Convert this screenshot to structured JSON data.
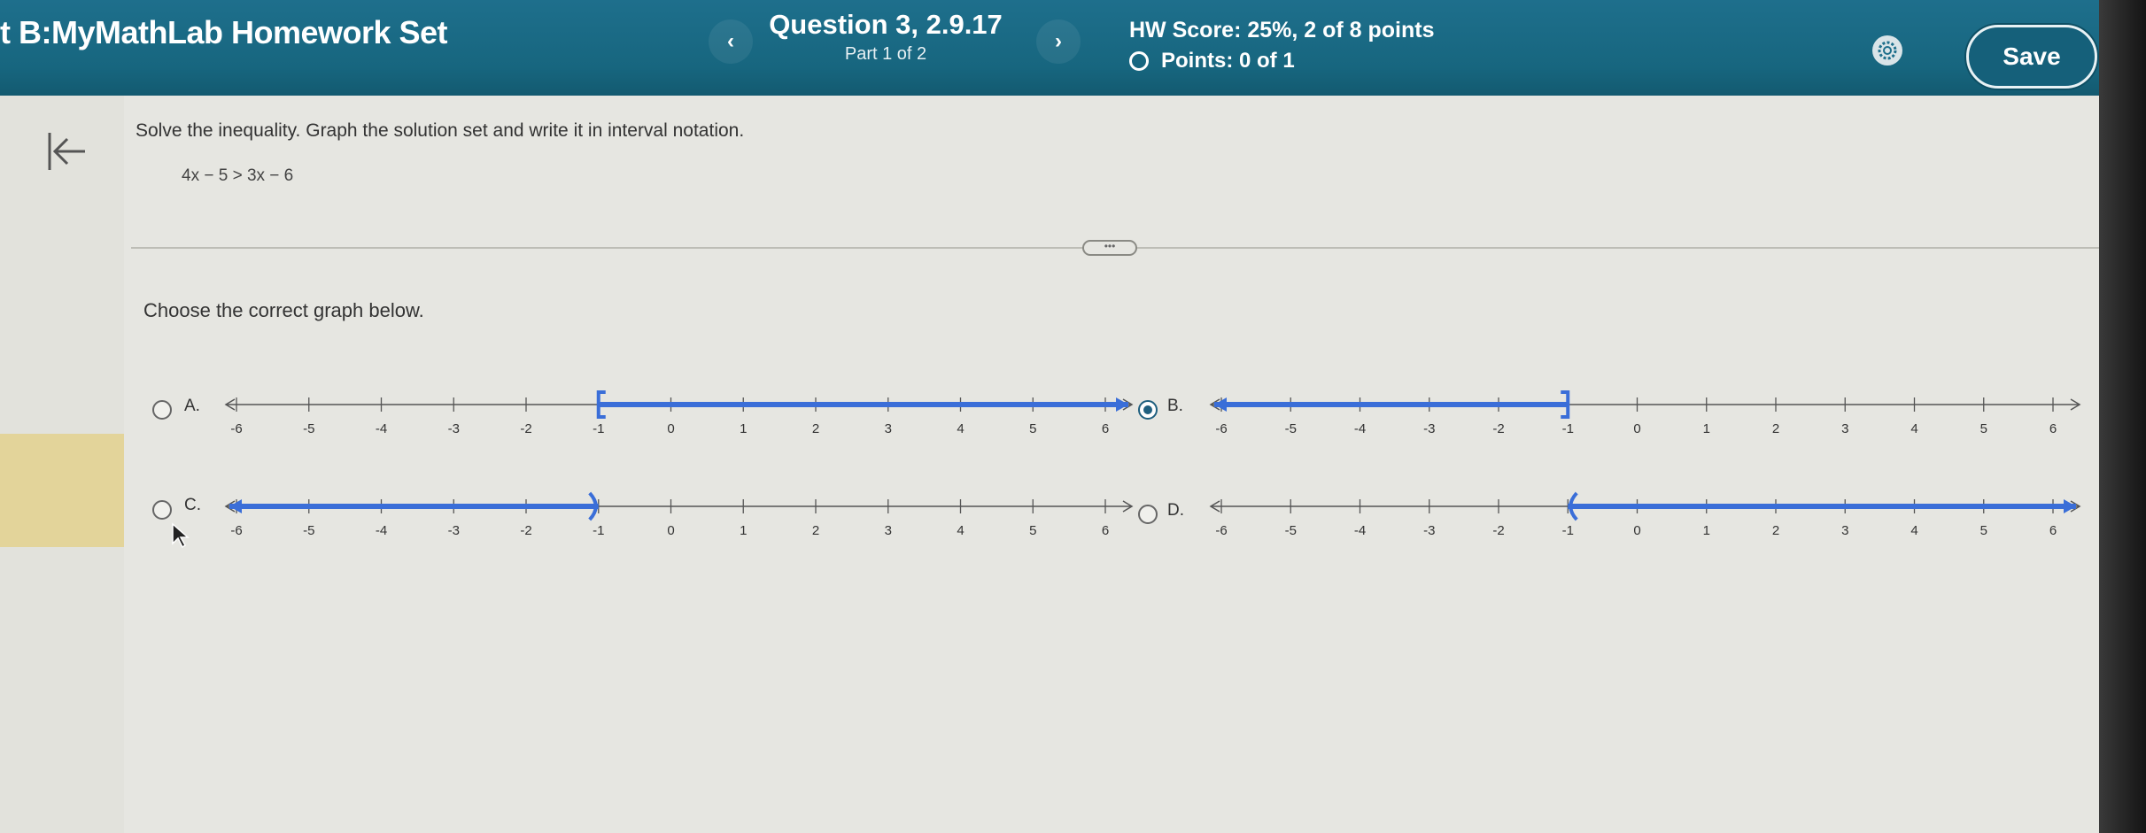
{
  "header": {
    "title": "t B:MyMathLab Homework Set",
    "prev_label": "‹",
    "next_label": "›",
    "question_title": "Question 3, 2.9.17",
    "question_part": "Part 1 of 2",
    "hw_score": "HW Score: 25%, 2 of 8 points",
    "points": "Points: 0 of 1",
    "save_label": "Save"
  },
  "problem": {
    "instructions": "Solve the inequality. Graph the solution set and write it in interval notation.",
    "inequality": "4x − 5 > 3x − 6",
    "handle": "•••",
    "prompt": "Choose the correct graph below."
  },
  "ticks": [
    "-6",
    "-5",
    "-4",
    "-3",
    "-2",
    "-1",
    "0",
    "1",
    "2",
    "3",
    "4",
    "5",
    "6"
  ],
  "options": [
    {
      "letter": "A.",
      "selected": false,
      "endpoint": -1,
      "bracket": "[",
      "direction": "right"
    },
    {
      "letter": "B.",
      "selected": true,
      "endpoint": -1,
      "bracket": "]",
      "direction": "left"
    },
    {
      "letter": "C.",
      "selected": false,
      "endpoint": -1,
      "bracket": ")",
      "direction": "left"
    },
    {
      "letter": "D.",
      "selected": false,
      "endpoint": -1,
      "bracket": "(",
      "direction": "right"
    }
  ],
  "colors": {
    "header": "#17667f",
    "accent_blue": "#3a6ed8",
    "axis": "#555555"
  }
}
